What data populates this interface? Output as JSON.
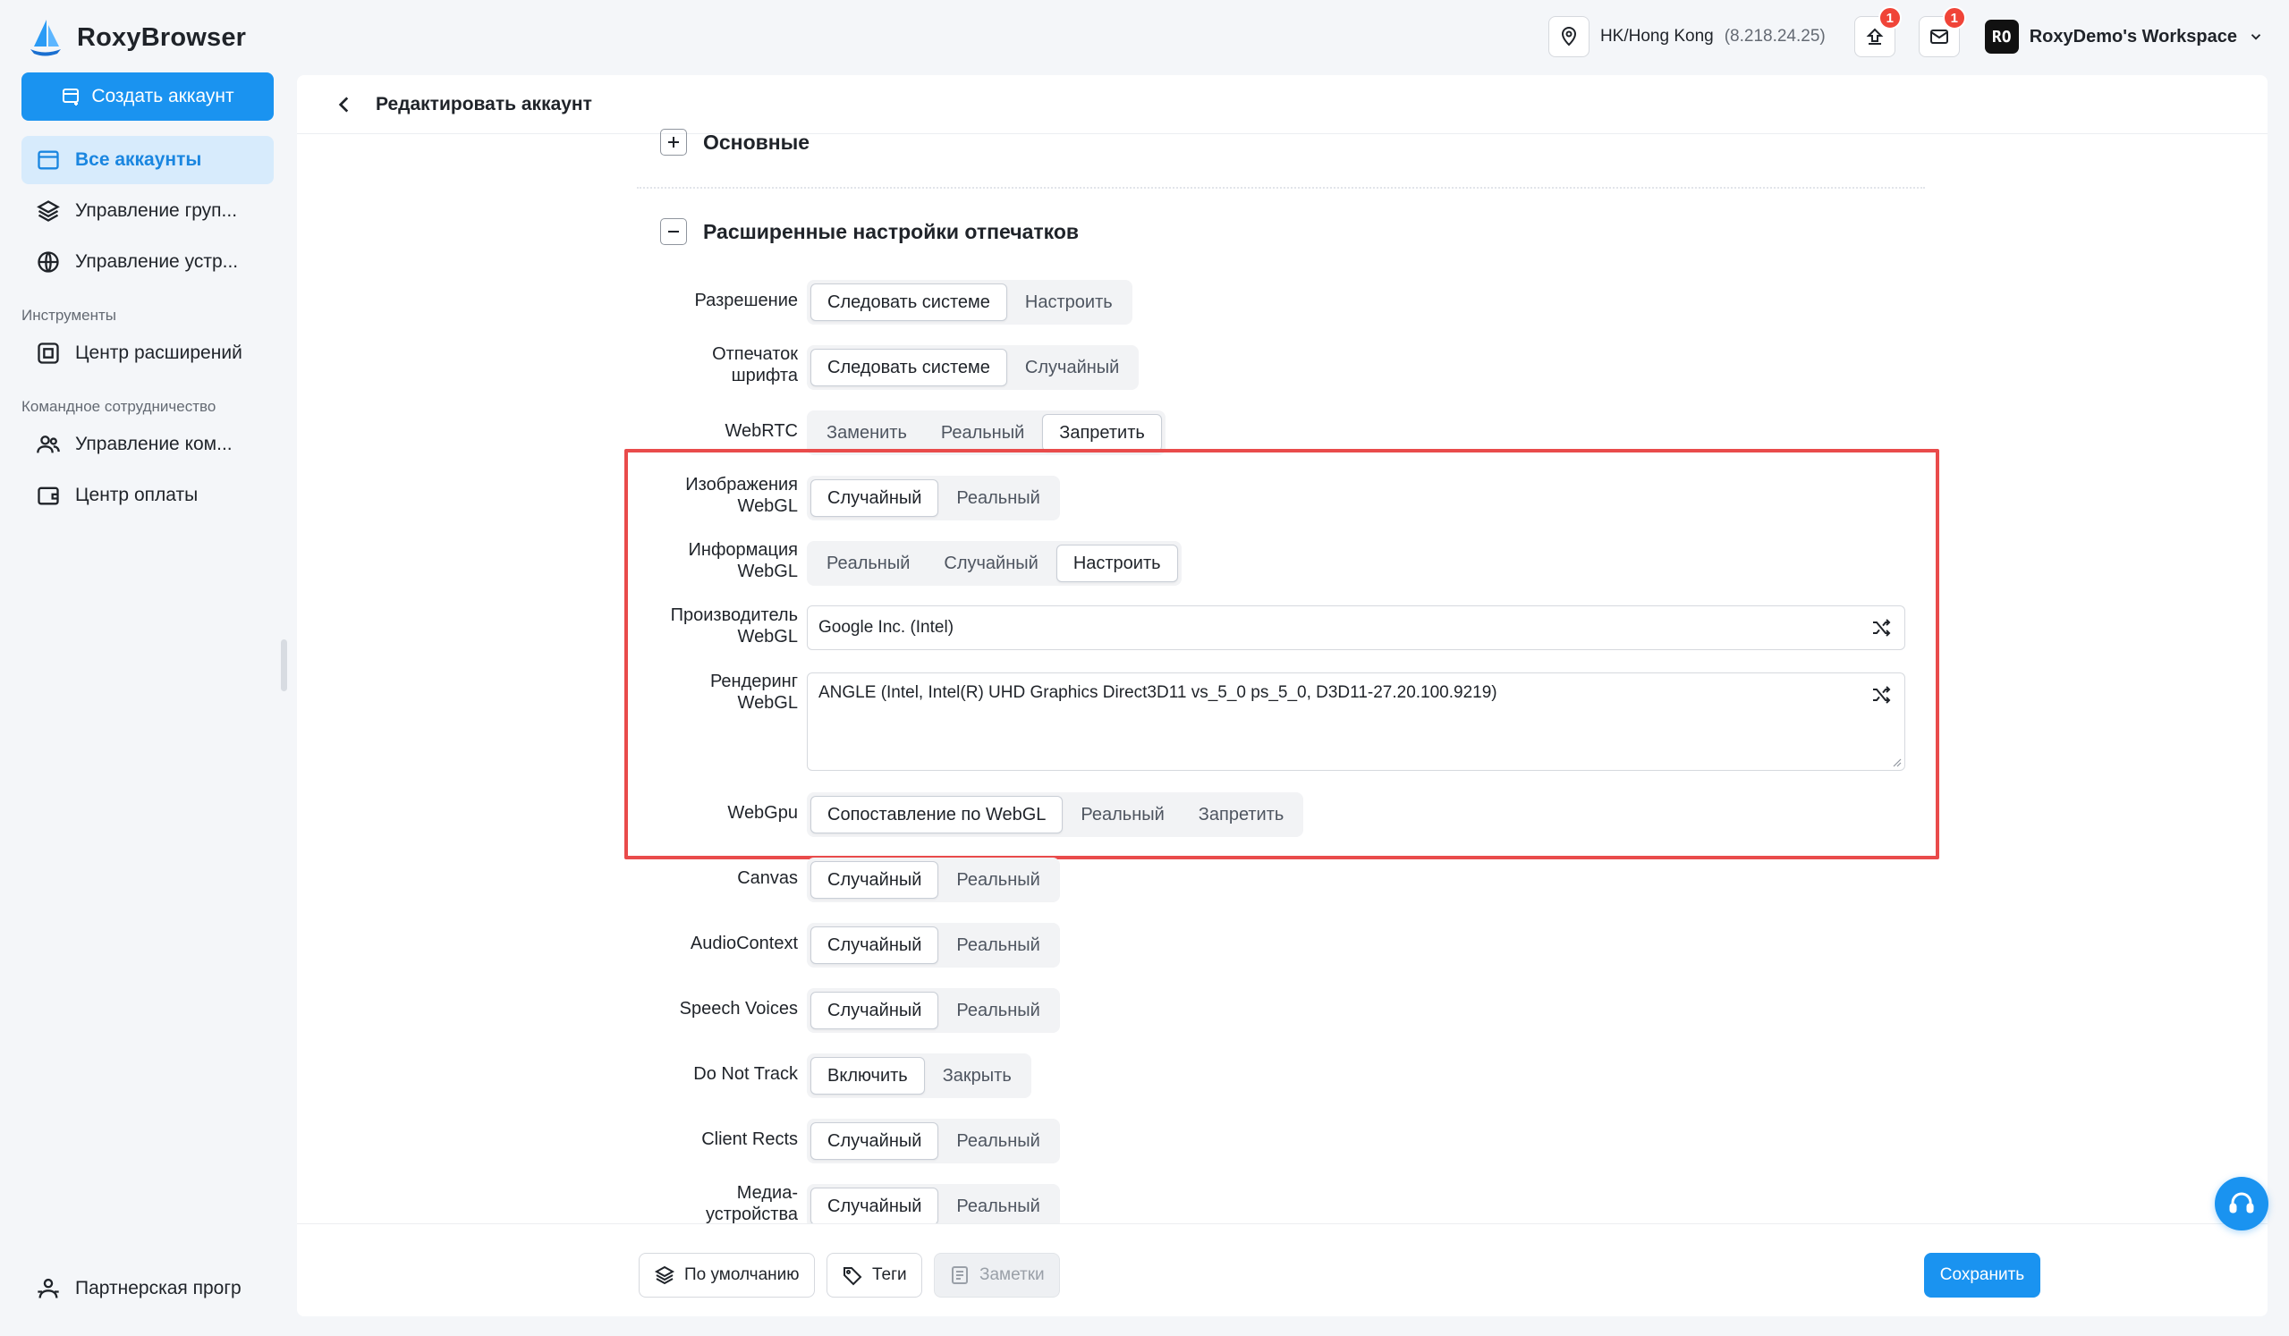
{
  "app": {
    "name": "RoxyBrowser"
  },
  "sidebar": {
    "create_label": "Создать аккаунт",
    "items": [
      {
        "label": "Все аккаунты",
        "icon": "accounts-icon"
      },
      {
        "label": "Управление груп...",
        "icon": "layers-icon"
      },
      {
        "label": "Управление устр...",
        "icon": "globe-icon"
      }
    ],
    "section_tools": "Инструменты",
    "tools": [
      {
        "label": "Центр расширений",
        "icon": "extension-icon"
      }
    ],
    "section_team": "Командное сотрудничество",
    "team": [
      {
        "label": "Управление ком...",
        "icon": "team-icon"
      },
      {
        "label": "Центр оплаты",
        "icon": "wallet-icon"
      }
    ],
    "partner_label": "Партнерская прогр"
  },
  "topbar": {
    "location": "HK/Hong Kong",
    "ip": "(8.218.24.25)",
    "upload_badge": "1",
    "mail_badge": "1",
    "workspace_initials": "RO",
    "workspace_name": "RoxyDemo's Workspace"
  },
  "page": {
    "title": "Редактировать аккаунт",
    "section_basic": "Основные",
    "section_advanced": "Расширенные настройки отпечатков"
  },
  "settings": {
    "resolution": {
      "label": "Разрешение",
      "options": [
        "Следовать системе",
        "Настроить"
      ]
    },
    "font": {
      "label1": "Отпечаток",
      "label2": "шрифта",
      "options": [
        "Следовать системе",
        "Случайный"
      ]
    },
    "webrtc": {
      "label": "WebRTC",
      "options": [
        "Заменить",
        "Реальный",
        "Запретить"
      ]
    },
    "webgl_image": {
      "label1": "Изображения",
      "label2": "WebGL",
      "options": [
        "Случайный",
        "Реальный"
      ]
    },
    "webgl_info": {
      "label1": "Информация",
      "label2": "WebGL",
      "options": [
        "Реальный",
        "Случайный",
        "Настроить"
      ]
    },
    "webgl_vendor": {
      "label1": "Производитель",
      "label2": "WebGL",
      "value": "Google Inc. (Intel)"
    },
    "webgl_renderer": {
      "label1": "Рендеринг",
      "label2": "WebGL",
      "value": "ANGLE (Intel, Intel(R) UHD Graphics Direct3D11 vs_5_0 ps_5_0, D3D11-27.20.100.9219)"
    },
    "webgpu": {
      "label": "WebGpu",
      "options": [
        "Сопоставление по WebGL",
        "Реальный",
        "Запретить"
      ]
    },
    "canvas": {
      "label": "Canvas",
      "options": [
        "Случайный",
        "Реальный"
      ]
    },
    "audio": {
      "label": "AudioContext",
      "options": [
        "Случайный",
        "Реальный"
      ]
    },
    "speech": {
      "label": "Speech Voices",
      "options": [
        "Случайный",
        "Реальный"
      ]
    },
    "dnt": {
      "label": "Do Not Track",
      "options": [
        "Включить",
        "Закрыть"
      ]
    },
    "client_rects": {
      "label": "Client Rects",
      "options": [
        "Случайный",
        "Реальный"
      ]
    },
    "media": {
      "label1": "Медиа-",
      "label2": "устройства",
      "options": [
        "Случайный",
        "Реальный"
      ]
    }
  },
  "footer": {
    "default_label": "По умолчанию",
    "tags_label": "Теги",
    "notes_label": "Заметки",
    "save_label": "Сохранить"
  },
  "colors": {
    "accent": "#1a93f0",
    "highlight": "#e94b4b",
    "badge": "#f04438"
  }
}
